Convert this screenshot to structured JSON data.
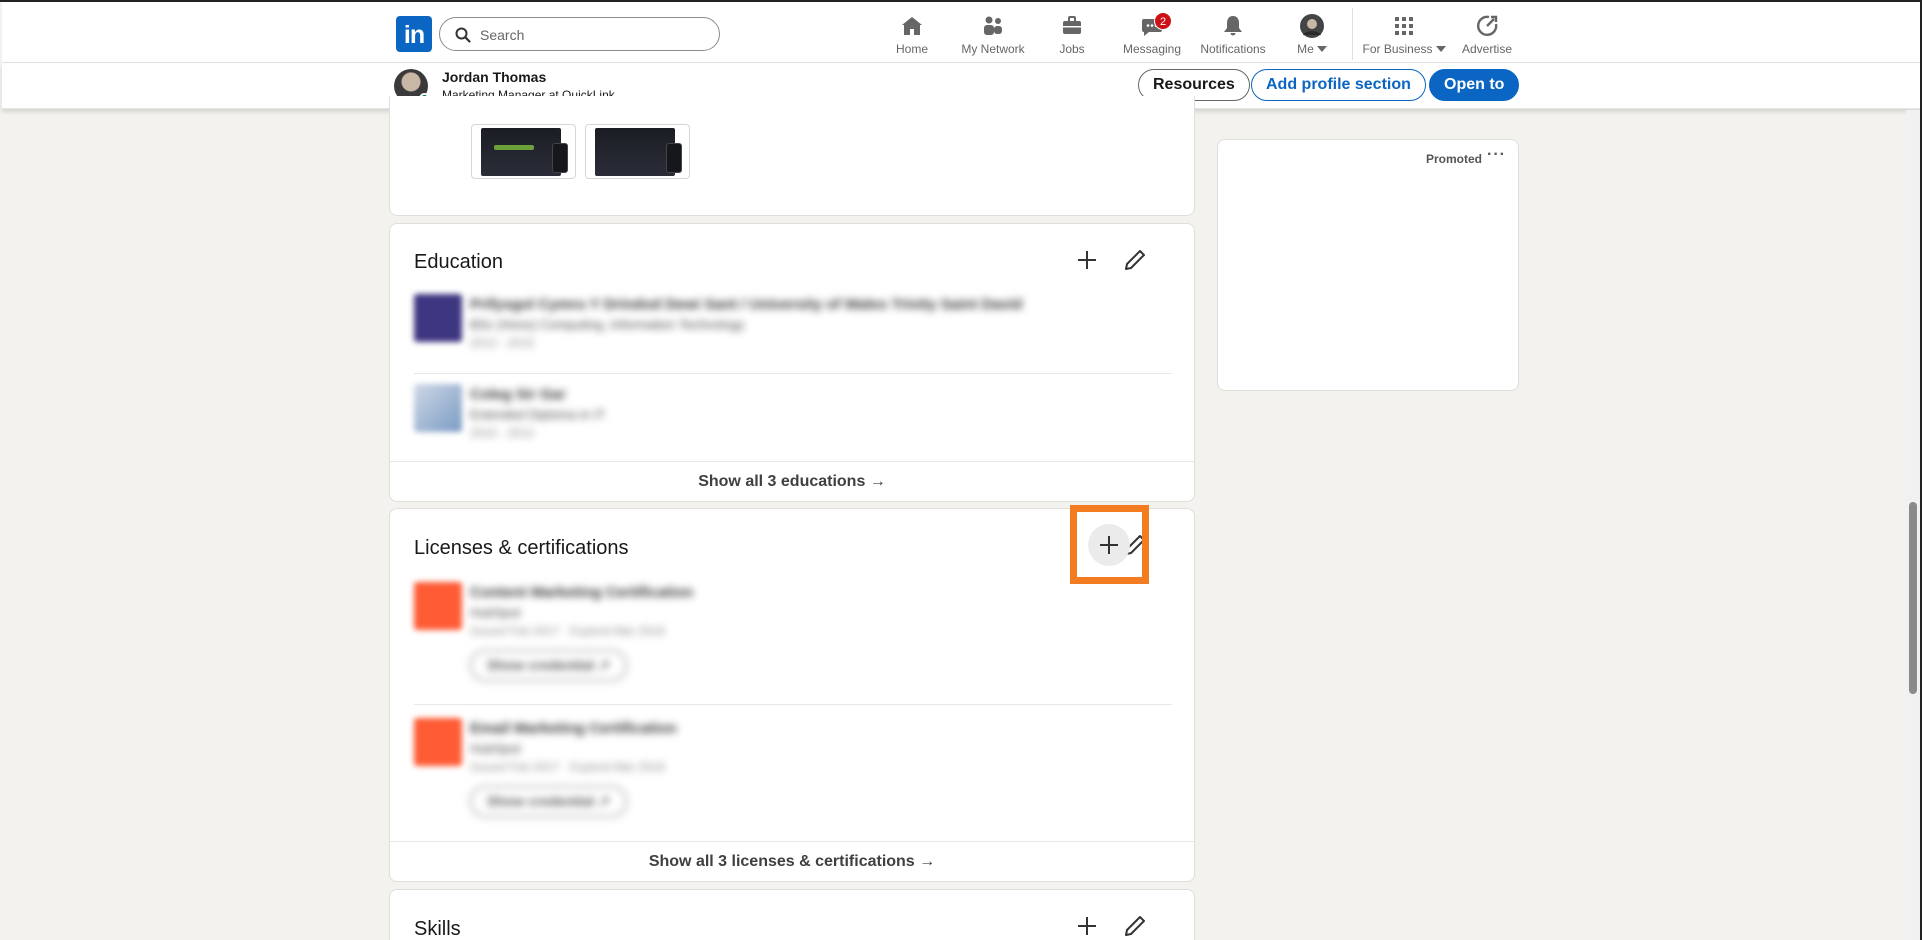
{
  "nav": {
    "logo_text": "in",
    "search_placeholder": "Search",
    "items": [
      {
        "label": "Home",
        "icon": "home-icon"
      },
      {
        "label": "My Network",
        "icon": "network-icon"
      },
      {
        "label": "Jobs",
        "icon": "briefcase-icon"
      },
      {
        "label": "Messaging",
        "icon": "messaging-icon",
        "badge": "2"
      },
      {
        "label": "Notifications",
        "icon": "bell-icon"
      },
      {
        "label": "Me",
        "icon": "avatar"
      },
      {
        "label": "For Business",
        "icon": "grid-icon"
      },
      {
        "label": "Advertise",
        "icon": "advertise-icon"
      }
    ]
  },
  "profile_bar": {
    "name": "Jordan Thomas",
    "headline": "Marketing Manager at QuickLink",
    "resources_label": "Resources",
    "add_section_label": "Add profile section",
    "open_to_label": "Open to"
  },
  "education": {
    "title": "Education",
    "entries": [
      {
        "school": "Prifysgol Cymru Y Drindod Dewi Sant / University of Wales Trinity Saint David",
        "degree": "BSc (Hons) Computing, Information Technology",
        "dates": "2012 - 2015"
      },
      {
        "school": "Coleg Sir Gar",
        "degree": "Extended Diploma in IT",
        "dates": "2010 - 2012"
      }
    ],
    "show_all": "Show all 3 educations →"
  },
  "licenses": {
    "title": "Licenses & certifications",
    "entries": [
      {
        "name": "Content Marketing Certification",
        "issuer": "HubSpot",
        "dates": "Issued Feb 2017 · Expired Mar 2019",
        "button": "Show credential ↗"
      },
      {
        "name": "Email Marketing Certification",
        "issuer": "HubSpot",
        "dates": "Issued Feb 2017 · Expired Mar 2019",
        "button": "Show credential ↗"
      }
    ],
    "show_all": "Show all 3 licenses & certifications →"
  },
  "skills": {
    "title": "Skills"
  },
  "ad": {
    "promoted_label": "Promoted",
    "more": "···"
  },
  "colors": {
    "brand": "#0a66c2",
    "highlight": "#f47c20",
    "badge": "#cc1016",
    "background": "#f4f2ee"
  }
}
